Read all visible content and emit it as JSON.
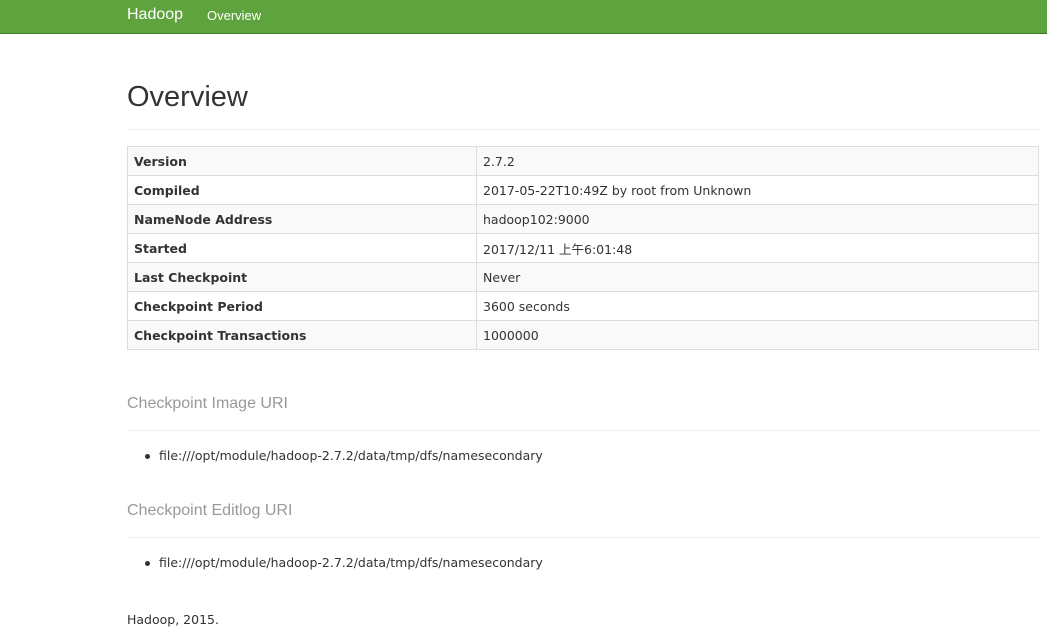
{
  "navbar": {
    "brand": "Hadoop",
    "links": [
      "Overview"
    ]
  },
  "page": {
    "title": "Overview"
  },
  "overview_table": [
    {
      "label": "Version",
      "value": "2.7.2"
    },
    {
      "label": "Compiled",
      "value": "2017-05-22T10:49Z by root from Unknown"
    },
    {
      "label": "NameNode Address",
      "value": "hadoop102:9000"
    },
    {
      "label": "Started",
      "value": "2017/12/11 上午6:01:48"
    },
    {
      "label": "Last Checkpoint",
      "value": "Never"
    },
    {
      "label": "Checkpoint Period",
      "value": "3600 seconds"
    },
    {
      "label": "Checkpoint Transactions",
      "value": "1000000"
    }
  ],
  "checkpoint_image": {
    "title": "Checkpoint Image URI",
    "uris": [
      "file:///opt/module/hadoop-2.7.2/data/tmp/dfs/namesecondary"
    ]
  },
  "checkpoint_editlog": {
    "title": "Checkpoint Editlog URI",
    "uris": [
      "file:///opt/module/hadoop-2.7.2/data/tmp/dfs/namesecondary"
    ]
  },
  "footer": {
    "text": "Hadoop, 2015."
  },
  "colors": {
    "navbar_bg": "#5fa33e",
    "section_title": "#999999"
  }
}
